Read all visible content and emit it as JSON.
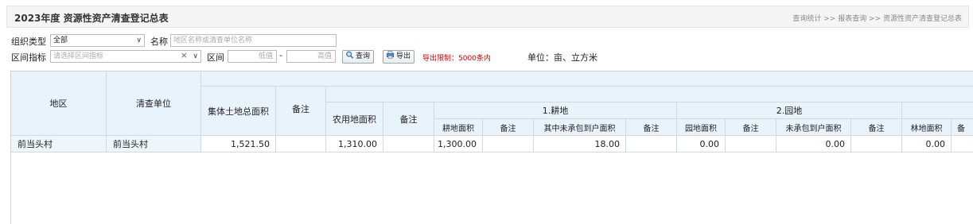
{
  "header": {
    "title": "2023年度 资源性资产清查登记总表",
    "breadcrumb": "查询统计 >> 报表查询 >> 资源性资产清查登记总表"
  },
  "filters": {
    "org_type_label": "组织类型",
    "org_type_value": "全部",
    "name_label": "名称",
    "name_placeholder": "地区名称或清查单位名称",
    "range_indicator_label": "区间指标",
    "range_indicator_placeholder": "请选择区间指标",
    "range_label": "区间",
    "low_placeholder": "低值",
    "dash": "-",
    "high_placeholder": "高值",
    "query_button": "查询",
    "export_button": "导出",
    "export_limit": "导出限制：5000条内",
    "unit": "单位：亩、立方米"
  },
  "table": {
    "headers": {
      "region": "地区",
      "unit": "清查单位",
      "collective_total": "集体土地总面积",
      "note": "备注",
      "agri_area": "农用地面积",
      "cultivated_group": "1.耕地",
      "garden_group": "2.园地",
      "cultivated_area": "耕地面积",
      "cultivated_unassigned": "其中未承包到户面积",
      "garden_area": "园地面积",
      "garden_unassigned": "未承包到户面积",
      "forest_area": "林地面积",
      "forest_note": "备"
    },
    "rows": [
      {
        "region": "前当头村",
        "unit": "前当头村",
        "collective_total": "1,521.50",
        "collective_note": "",
        "agri_area": "1,310.00",
        "agri_note": "",
        "cultivated_area": "1,300.00",
        "cultivated_note": "",
        "cultivated_unassigned": "18.00",
        "cultivated_unassigned_note": "",
        "garden_area": "0.00",
        "garden_note": "",
        "garden_unassigned": "0.00",
        "garden_unassigned_note": "",
        "forest_area": "0.00"
      }
    ]
  },
  "colors": {
    "header_bg": "#e9f3fb",
    "warning": "#d40000",
    "border": "#cfd9e0"
  }
}
